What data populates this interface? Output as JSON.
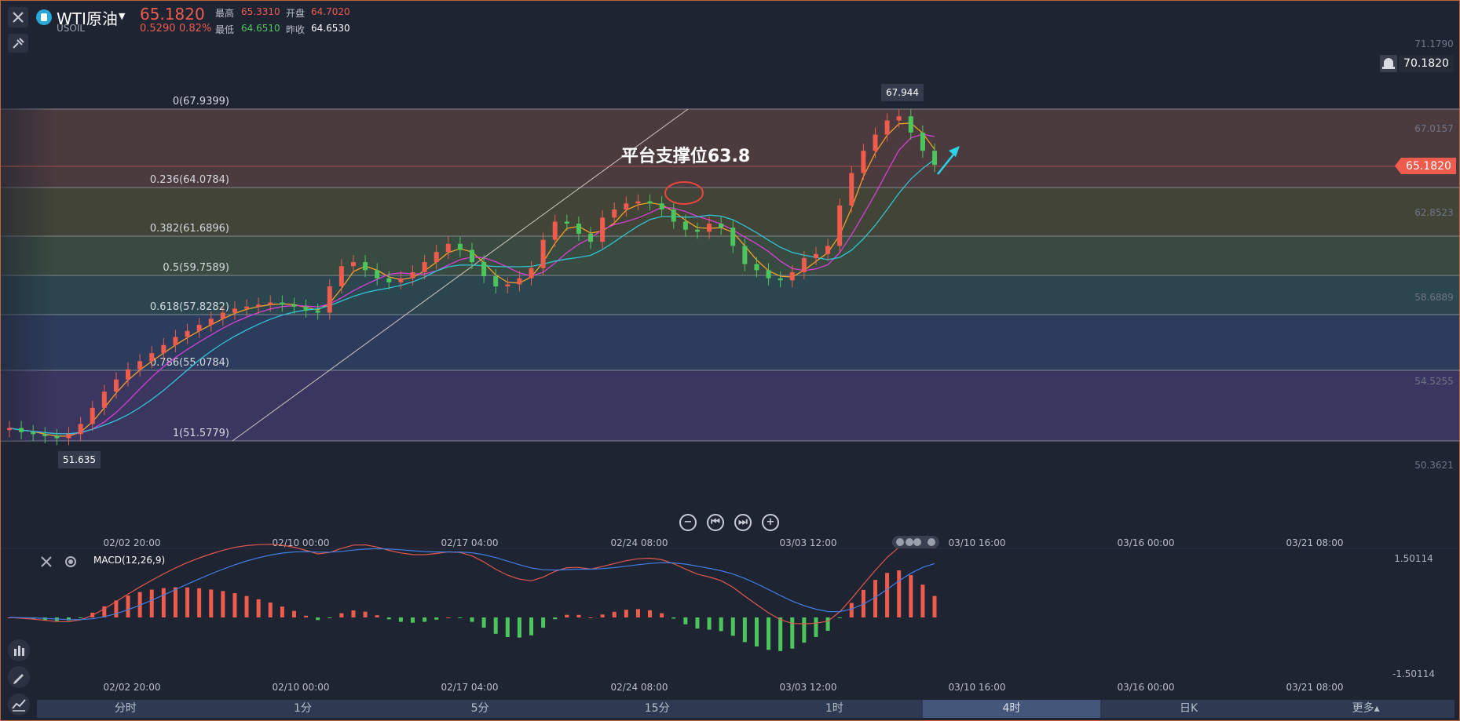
{
  "header": {
    "symbol_name": "WTI原油",
    "symbol_code": "USOIL",
    "last_price": "65.1820",
    "change": "0.5290",
    "change_percent": "0.82%",
    "high_label": "最高",
    "high_value": "65.3310",
    "low_label": "最低",
    "low_value": "64.6510",
    "open_label": "开盘",
    "open_value": "64.7020",
    "prev_close_label": "昨收",
    "prev_close_value": "64.6530"
  },
  "colors": {
    "up": "#ef5b4c",
    "down": "#4cc65c",
    "background": "#1f2433",
    "ma_fast": "#f0a12a",
    "ma_mid": "#d83fd6",
    "ma_slow": "#2fc4d4",
    "macd_dif": "#e2574c",
    "macd_dea": "#3f7fe6"
  },
  "icons": {
    "close": "close-icon",
    "pin": "pin-icon",
    "symbol": "symbol-icon",
    "dropdown": "chevron-down-icon",
    "bell": "bell-icon",
    "macd_close": "close-icon",
    "macd_settings": "settings-icon",
    "zoom_out": "zoom-out-icon",
    "jump_start": "jump-start-icon",
    "jump_end": "jump-end-icon",
    "zoom_in": "zoom-in-icon",
    "tool_indicator": "indicator-icon",
    "tool_draw": "pencil-icon",
    "tool_compare": "compare-icon"
  },
  "price_axis": {
    "ticks": [
      "71.1790",
      "67.0157",
      "62.8523",
      "58.6889",
      "54.5255",
      "50.3621"
    ],
    "alert_price": "70.1820",
    "current_price_tag": "65.1820"
  },
  "fibonacci": [
    {
      "label": "0(67.9399)"
    },
    {
      "label": "0.236(64.0784)"
    },
    {
      "label": "0.382(61.6896)"
    },
    {
      "label": "0.5(59.7589)"
    },
    {
      "label": "0.618(57.8282)"
    },
    {
      "label": "0.786(55.0784)"
    },
    {
      "label": "1(51.5779)"
    }
  ],
  "annotations": {
    "headline": "平台支撑位63.8",
    "high_marker": "67.944",
    "low_marker": "51.635"
  },
  "time_axis": [
    "02/02 20:00",
    "02/10 00:00",
    "02/17 04:00",
    "02/24 08:00",
    "03/03 12:00",
    "03/10 16:00",
    "03/16 00:00",
    "03/21 08:00"
  ],
  "macd": {
    "label": "MACD(12,26,9)",
    "axis_ticks": [
      "1.50114",
      "-1.50114"
    ]
  },
  "timeframes": [
    {
      "label": "分时",
      "active": false
    },
    {
      "label": "1分",
      "active": false
    },
    {
      "label": "5分",
      "active": false
    },
    {
      "label": "15分",
      "active": false
    },
    {
      "label": "1时",
      "active": false
    },
    {
      "label": "4时",
      "active": true
    },
    {
      "label": "日K",
      "active": false
    },
    {
      "label": "更多▴",
      "active": false
    }
  ],
  "chart_data": {
    "type": "candlestick",
    "interval": "4时",
    "price_range": [
      50.3621,
      71.179
    ],
    "series": [
      {
        "name": "candles_close_approx",
        "values": [
          52.2,
          52.0,
          51.9,
          51.8,
          51.7,
          51.9,
          52.4,
          53.2,
          54.0,
          54.6,
          55.1,
          55.5,
          55.9,
          56.3,
          56.7,
          57.0,
          57.3,
          57.6,
          57.9,
          58.1,
          58.2,
          58.3,
          58.4,
          58.3,
          58.2,
          58.0,
          57.9,
          59.2,
          60.2,
          60.4,
          60.0,
          59.6,
          59.4,
          59.6,
          59.9,
          60.4,
          60.9,
          61.3,
          61.0,
          60.4,
          59.7,
          59.2,
          59.3,
          59.6,
          60.1,
          61.5,
          62.4,
          62.3,
          61.8,
          61.4,
          62.6,
          63.0,
          63.3,
          63.4,
          63.3,
          63.0,
          62.4,
          62.0,
          61.9,
          62.3,
          62.1,
          61.2,
          60.3,
          60.0,
          59.6,
          59.5,
          59.9,
          60.6,
          60.8,
          61.2,
          63.2,
          64.8,
          65.9,
          66.7,
          67.4,
          67.6,
          66.8,
          65.9,
          65.2
        ]
      }
    ]
  }
}
